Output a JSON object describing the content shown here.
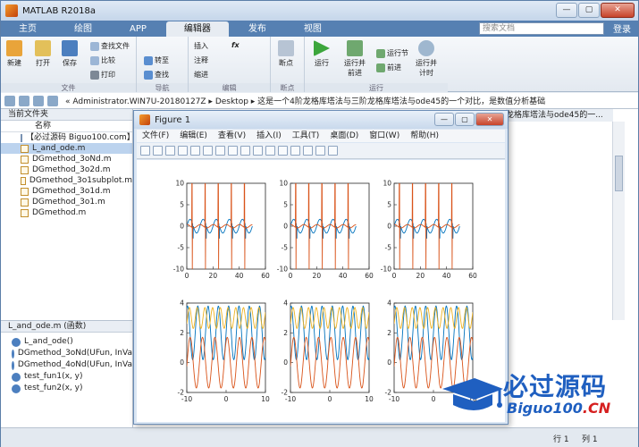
{
  "window": {
    "title": "MATLAB R2018a"
  },
  "tabs": [
    {
      "label": "主页"
    },
    {
      "label": "绘图"
    },
    {
      "label": "APP"
    },
    {
      "label": "编辑器"
    },
    {
      "label": "发布"
    },
    {
      "label": "视图"
    }
  ],
  "search_placeholder": "搜索文档",
  "login_label": "登录",
  "ribbon": {
    "file_group": "文件",
    "nav_group": "导航",
    "edit_group": "编辑",
    "bp_group": "断点",
    "run_group": "运行",
    "new": "新建",
    "open": "打开",
    "save": "保存",
    "find_files": "查找文件",
    "compare": "比较",
    "print": "打印",
    "goto": "转至",
    "find": "查找",
    "insert": "插入",
    "comment": "注释",
    "indent": "缩进",
    "fx": "fx",
    "breakpoints": "断点",
    "run": "运行",
    "run_advance": "运行并\n前进",
    "run_section": "运行节",
    "advance": "前进",
    "run_time": "运行并\n计时"
  },
  "address": {
    "path": "« Administrator.WIN7U-20180127Z  ▸  Desktop  ▸  这是一个4阶龙格库塔法与三阶龙格库塔法与ode45的一个对比，是数值分析基础"
  },
  "current_folder": {
    "title": "当前文件夹",
    "column": "名称",
    "files": [
      {
        "name": "【必过源码 Biguo100.com】",
        "kind": "doc"
      },
      {
        "name": "L_and_ode.m",
        "kind": "m",
        "selected": true
      },
      {
        "name": "DGmethod_3oNd.m",
        "kind": "m"
      },
      {
        "name": "DGmethod_3o2d.m",
        "kind": "m"
      },
      {
        "name": "DGmethod_3o1subplot.m",
        "kind": "m"
      },
      {
        "name": "DGmethod_3o1d.m",
        "kind": "m"
      },
      {
        "name": "DGmethod_3o1.m",
        "kind": "m"
      },
      {
        "name": "DGmethod.m",
        "kind": "m"
      }
    ]
  },
  "details": {
    "title": "L_and_ode.m  (函数)",
    "items": [
      "L_and_ode()",
      "DGmethod_3oNd(UFun, InVa",
      "DGmethod_4oNd(UFun, InVa",
      "test_fun1(x, y)",
      "test_fun2(x, y)"
    ]
  },
  "right_strip_text": "龙格库塔法与ode45的一...",
  "status": {
    "line_label": "行",
    "line": "1",
    "col_label": "列",
    "col": "1"
  },
  "figure": {
    "title": "Figure 1",
    "menu": [
      "文件(F)",
      "编辑(E)",
      "查看(V)",
      "插入(I)",
      "工具(T)",
      "桌面(D)",
      "窗口(W)",
      "帮助(H)"
    ]
  },
  "chart_data": [
    {
      "type": "line",
      "position": "top-left",
      "xlim": [
        0,
        60
      ],
      "ylim": [
        -10,
        10
      ],
      "xticks": [
        0,
        20,
        40,
        60
      ],
      "yticks": [
        -10,
        -5,
        0,
        5,
        10
      ],
      "series": [
        {
          "color": "#0072bd"
        },
        {
          "color": "#d95319"
        }
      ]
    },
    {
      "type": "line",
      "position": "top-middle",
      "xlim": [
        0,
        60
      ],
      "ylim": [
        -10,
        10
      ],
      "xticks": [
        0,
        20,
        40,
        60
      ],
      "yticks": [
        -10,
        -5,
        0,
        5,
        10
      ],
      "series": [
        {
          "color": "#0072bd"
        },
        {
          "color": "#d95319"
        }
      ]
    },
    {
      "type": "line",
      "position": "top-right",
      "xlim": [
        0,
        60
      ],
      "ylim": [
        -10,
        10
      ],
      "xticks": [
        0,
        20,
        40,
        60
      ],
      "yticks": [
        -10,
        -5,
        0,
        5,
        10
      ],
      "series": [
        {
          "color": "#0072bd"
        },
        {
          "color": "#d95319"
        }
      ]
    },
    {
      "type": "line",
      "position": "bottom-left",
      "xlim": [
        -10,
        10
      ],
      "ylim": [
        -2,
        4
      ],
      "xticks": [
        -10,
        0,
        10
      ],
      "yticks": [
        -2,
        0,
        2,
        4
      ],
      "series": [
        {
          "color": "#0072bd"
        },
        {
          "color": "#d95319"
        },
        {
          "color": "#edb120"
        }
      ]
    },
    {
      "type": "line",
      "position": "bottom-middle",
      "xlim": [
        -10,
        10
      ],
      "ylim": [
        -2,
        4
      ],
      "xticks": [
        -10,
        0,
        10
      ],
      "yticks": [
        -2,
        0,
        2,
        4
      ],
      "series": [
        {
          "color": "#0072bd"
        },
        {
          "color": "#d95319"
        },
        {
          "color": "#edb120"
        }
      ]
    },
    {
      "type": "line",
      "position": "bottom-right",
      "xlim": [
        -10,
        10
      ],
      "ylim": [
        -2,
        4
      ],
      "xticks": [
        -10,
        0,
        10
      ],
      "yticks": [
        -2,
        0,
        2,
        4
      ],
      "series": [
        {
          "color": "#0072bd"
        },
        {
          "color": "#d95319"
        },
        {
          "color": "#edb120"
        }
      ]
    }
  ],
  "watermark": {
    "title": "必过源码",
    "site_main": "Biguo100",
    "site_suffix": ".CN"
  }
}
